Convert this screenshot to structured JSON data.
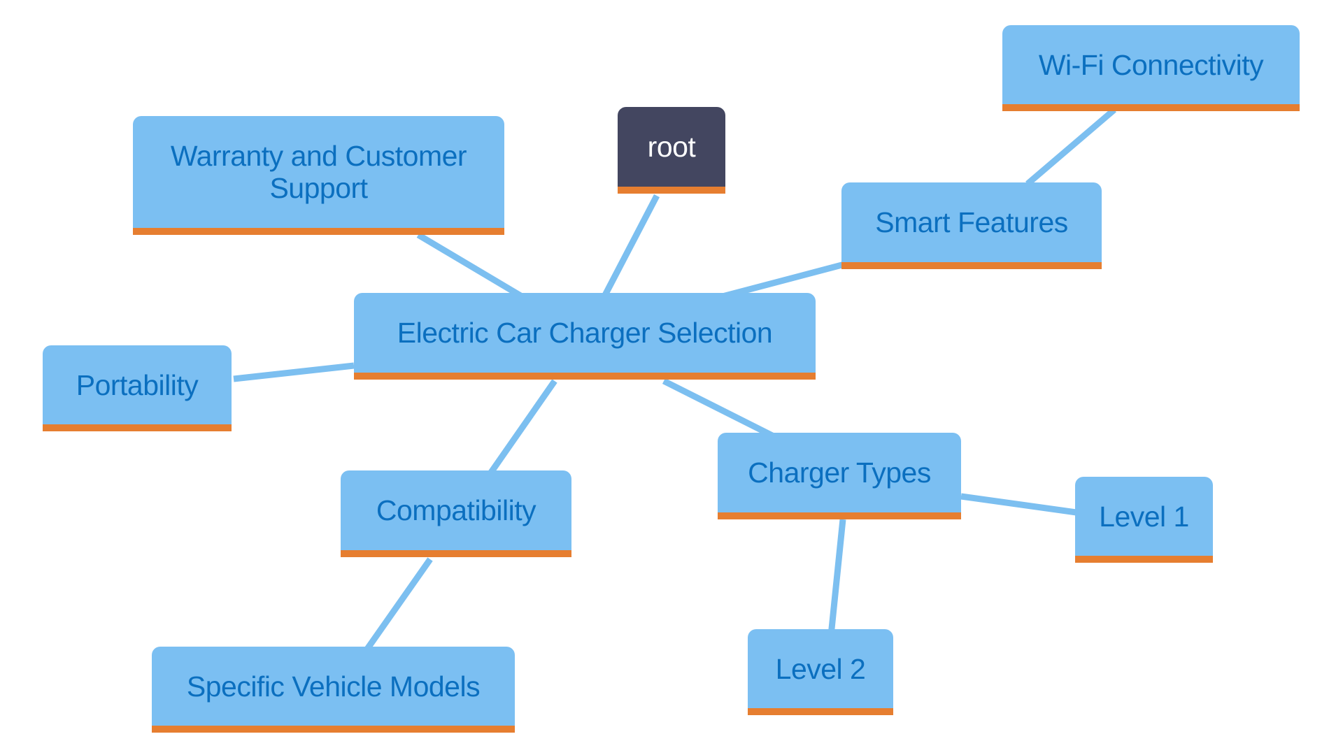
{
  "diagram": {
    "type": "mindmap",
    "colors": {
      "node_fill": "#7bbff2",
      "node_text": "#0b6fbf",
      "node_underline": "#e67e30",
      "root_fill": "#434660",
      "root_text": "#ffffff",
      "edge": "#7cbff0",
      "background": "#ffffff"
    },
    "nodes": {
      "root": {
        "label": "root"
      },
      "center": {
        "label": "Electric Car Charger Selection"
      },
      "warranty": {
        "label": "Warranty and Customer Support"
      },
      "smart": {
        "label": "Smart Features"
      },
      "wifi": {
        "label": "Wi-Fi Connectivity"
      },
      "portability": {
        "label": "Portability"
      },
      "compatibility": {
        "label": "Compatibility"
      },
      "specific": {
        "label": "Specific Vehicle Models"
      },
      "charger_types": {
        "label": "Charger Types"
      },
      "level1": {
        "label": "Level 1"
      },
      "level2": {
        "label": "Level 2"
      }
    },
    "edges": [
      {
        "from": "root",
        "to": "center"
      },
      {
        "from": "center",
        "to": "warranty"
      },
      {
        "from": "center",
        "to": "smart"
      },
      {
        "from": "smart",
        "to": "wifi"
      },
      {
        "from": "center",
        "to": "portability"
      },
      {
        "from": "center",
        "to": "compatibility"
      },
      {
        "from": "compatibility",
        "to": "specific"
      },
      {
        "from": "center",
        "to": "charger_types"
      },
      {
        "from": "charger_types",
        "to": "level1"
      },
      {
        "from": "charger_types",
        "to": "level2"
      }
    ]
  }
}
